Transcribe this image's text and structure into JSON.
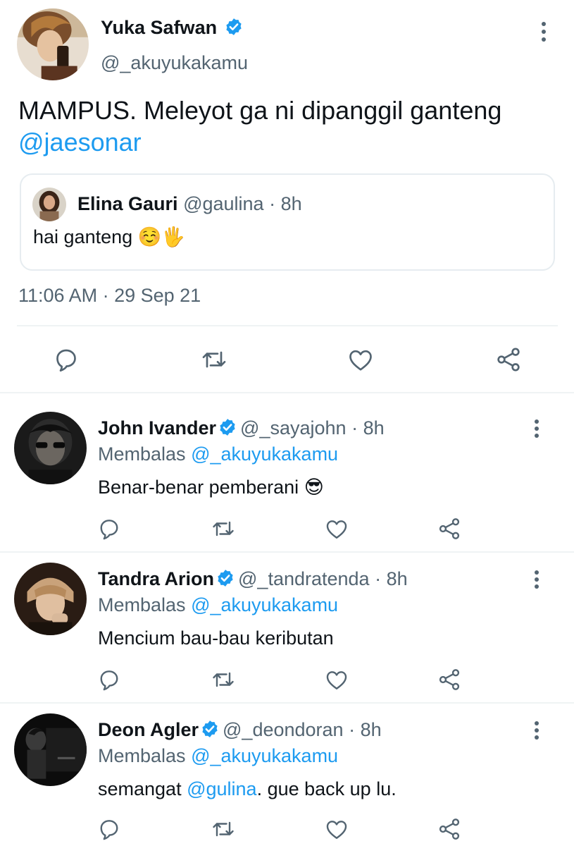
{
  "main_tweet": {
    "author_name": "Yuka Safwan",
    "handle": "@_akuyukakamu",
    "text": "MAMPUS. Meleyot ga ni dipanggil ganteng",
    "mention": "@jaesonar",
    "quoted": {
      "author_name": "Elina Gauri",
      "handle": "@gaulina",
      "time_sep": "·",
      "time": "8h",
      "text": "hai ganteng",
      "emoji": "☺️🖐"
    },
    "timestamp": "11:06 AM · 29 Sep 21"
  },
  "reply_prefix": "Membalas",
  "replies": [
    {
      "author_name": "John Ivander",
      "handle": "@_sayajohn",
      "time_sep": "·",
      "time": "8h",
      "reply_to": "@_akuyukakamu",
      "text": "Benar-benar pemberani",
      "emoji": "😎"
    },
    {
      "author_name": "Tandra Arion",
      "handle": "@_tandratenda",
      "time_sep": "·",
      "time": "8h",
      "reply_to": "@_akuyukakamu",
      "text": "Mencium bau-bau keributan",
      "emoji": ""
    },
    {
      "author_name": "Deon Agler",
      "handle": "@_deondoran",
      "time_sep": "·",
      "time": "8h",
      "reply_to": "@_akuyukakamu",
      "text_before": "semangat",
      "mention": "@gulina",
      "text_after": ". gue back up lu."
    }
  ],
  "icons": {
    "reply": "reply-icon",
    "retweet": "retweet-icon",
    "like": "heart-icon",
    "share": "share-icon",
    "verified": "verified-badge-icon",
    "more": "more-vertical-icon"
  },
  "colors": {
    "text": "#0f1419",
    "muted": "#536471",
    "link": "#1d9bf0",
    "verified": "#1d9bf0",
    "divider": "#eff3f4"
  }
}
